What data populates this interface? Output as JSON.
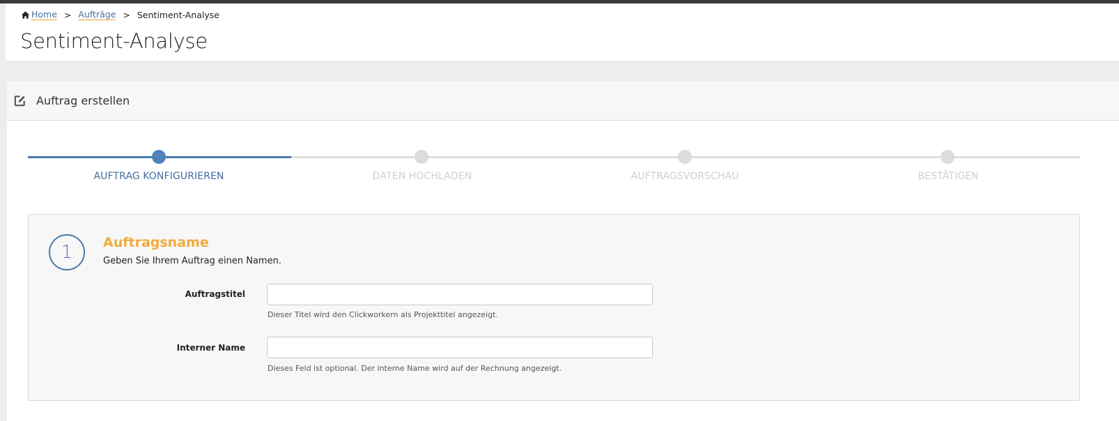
{
  "breadcrumb": {
    "home": "Home",
    "orders": "Aufträge",
    "current": "Sentiment-Analyse",
    "separator": ">"
  },
  "page_title": "Sentiment-Analyse",
  "panel": {
    "title": "Auftrag erstellen",
    "icon": "edit-icon"
  },
  "stepper": {
    "active_index": 0,
    "steps": [
      {
        "label": "AUFTRAG KONFIGURIEREN"
      },
      {
        "label": "DATEN HOCHLADEN"
      },
      {
        "label": "AUFTRAGSVORSCHAU"
      },
      {
        "label": "BESTÄTIGEN"
      }
    ]
  },
  "section": {
    "number": "1",
    "title": "Auftragsname",
    "description": "Geben Sie Ihrem Auftrag einen Namen."
  },
  "fields": {
    "title": {
      "label": "Auftragstitel",
      "value": "",
      "help": "Dieser Titel wird den Clickworkern als Projekttitel angezeigt."
    },
    "internal": {
      "label": "Interner Name",
      "value": "",
      "help": "Dieses Feld ist optional. Der interne Name wird auf der Rechnung angezeigt."
    }
  },
  "colors": {
    "accent_blue": "#4a79ad",
    "accent_orange": "#f0ab3c",
    "inactive_gray": "#dcdcdc"
  }
}
